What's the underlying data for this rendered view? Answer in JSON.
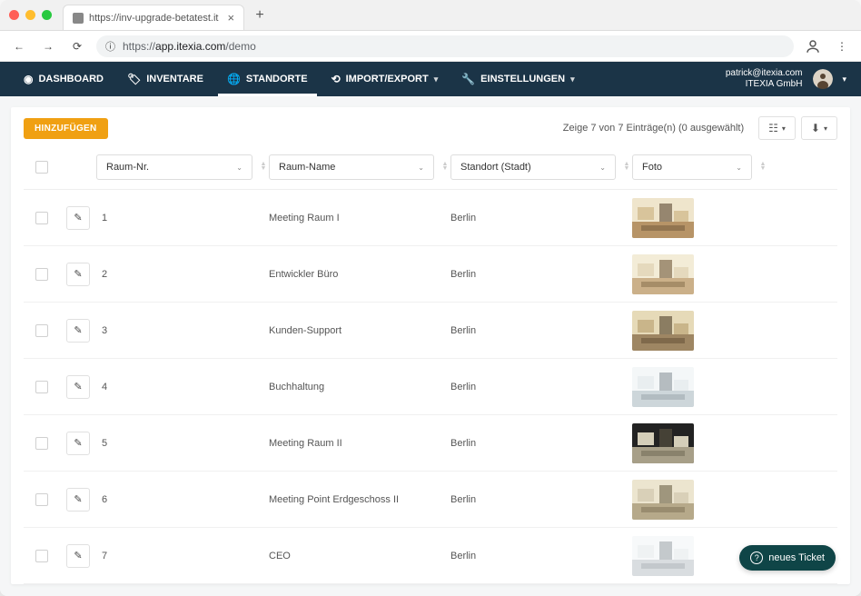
{
  "browser": {
    "tab_title": "https://inv-upgrade-betatest.it",
    "url_https": "https://",
    "url_host": "app.itexia.com",
    "url_path": "/demo"
  },
  "nav": {
    "items": [
      {
        "label": "DASHBOARD",
        "icon": "gauge"
      },
      {
        "label": "INVENTARE",
        "icon": "tag"
      },
      {
        "label": "STANDORTE",
        "icon": "globe",
        "active": true
      },
      {
        "label": "IMPORT/EXPORT",
        "icon": "sync",
        "caret": true
      },
      {
        "label": "EINSTELLUNGEN",
        "icon": "wrench",
        "caret": true
      }
    ],
    "user_email": "patrick@itexia.com",
    "user_org": "ITEXIA GmbH"
  },
  "toolbar": {
    "add_label": "HINZUFÜGEN",
    "entries_text": "Zeige 7 von 7 Einträge(n) (0 ausgewählt)"
  },
  "columns": {
    "c1": "Raum-Nr.",
    "c2": "Raum-Name",
    "c3": "Standort (Stadt)",
    "c4": "Foto"
  },
  "rows": [
    {
      "num": "1",
      "name": "Meeting Raum I",
      "city": "Berlin"
    },
    {
      "num": "2",
      "name": "Entwickler Büro",
      "city": "Berlin"
    },
    {
      "num": "3",
      "name": "Kunden-Support",
      "city": "Berlin"
    },
    {
      "num": "4",
      "name": "Buchhaltung",
      "city": "Berlin"
    },
    {
      "num": "5",
      "name": "Meeting Raum II",
      "city": "Berlin"
    },
    {
      "num": "6",
      "name": "Meeting Point Erdgeschoss II",
      "city": "Berlin"
    },
    {
      "num": "7",
      "name": "CEO",
      "city": "Berlin"
    }
  ],
  "ticket_label": "neues Ticket"
}
